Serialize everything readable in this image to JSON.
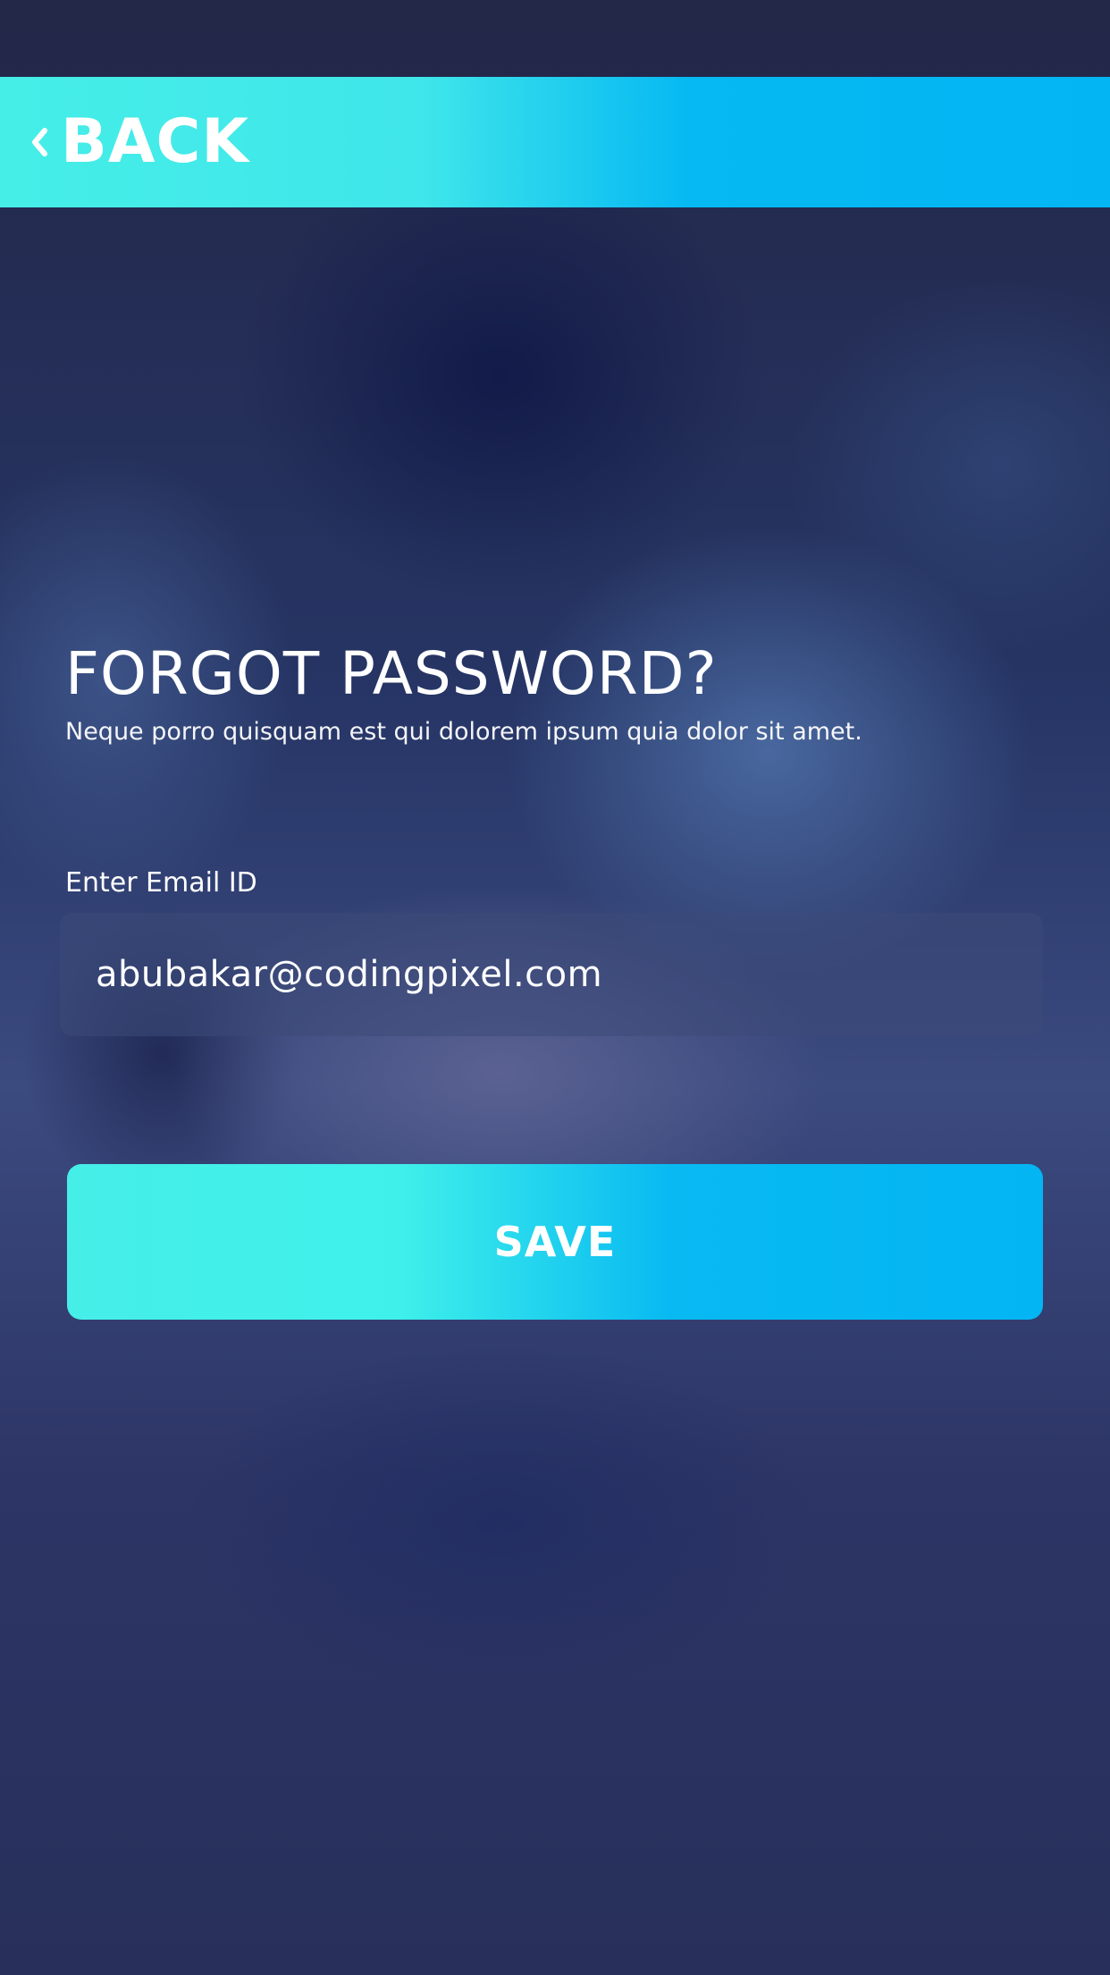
{
  "header": {
    "back_label": "BACK"
  },
  "main": {
    "title": "FORGOT PASSWORD?",
    "subtitle": "Neque porro quisquam est qui dolorem ipsum quia dolor sit amet.",
    "email_label": "Enter Email ID",
    "email_value": "abubakar@codingpixel.com",
    "save_label": "SAVE"
  },
  "icons": {
    "back": "chevron-left-icon"
  },
  "colors": {
    "accent_cyan": "#46eee8",
    "accent_blue": "#03b5f3",
    "background": "#27305a",
    "text": "#ffffff"
  }
}
